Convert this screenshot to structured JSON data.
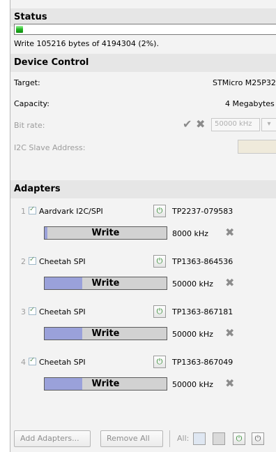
{
  "status": {
    "title": "Status",
    "progress": 0.025,
    "message": "Write 105216 bytes of 4194304 (2%)."
  },
  "device_control": {
    "title": "Device Control",
    "target_label": "Target:",
    "target_value": "STMicro M25P32",
    "capacity_label": "Capacity:",
    "capacity_value": "4 Megabytes",
    "bitrate_label": "Bit rate:",
    "bitrate_value": "50000 kHz",
    "bitrate_icons": [
      "check-icon",
      "x-icon"
    ],
    "i2c_label": "I2C Slave Address:",
    "i2c_value": ""
  },
  "adapters": {
    "title": "Adapters",
    "items": [
      {
        "index": "1",
        "name": "Aardvark I2C/SPI",
        "serial": "TP2237-079583",
        "action": "Write",
        "rate": "8000 kHz",
        "progress": 0.02
      },
      {
        "index": "2",
        "name": "Cheetah SPI",
        "serial": "TP1363-864536",
        "action": "Write",
        "rate": "50000 kHz",
        "progress": 0.31
      },
      {
        "index": "3",
        "name": "Cheetah SPI",
        "serial": "TP1363-867181",
        "action": "Write",
        "rate": "50000 kHz",
        "progress": 0.31
      },
      {
        "index": "4",
        "name": "Cheetah SPI",
        "serial": "TP1363-867049",
        "action": "Write",
        "rate": "50000 kHz",
        "progress": 0.31
      }
    ]
  },
  "footer": {
    "add_label": "Add Adapters...",
    "remove_label": "Remove All",
    "all_label": "All:"
  },
  "colors": {
    "progress_green": "#22b522",
    "write_fill": "#9aa1da",
    "header_bg": "#e6e6e6",
    "power_green": "#2e8b2e"
  }
}
